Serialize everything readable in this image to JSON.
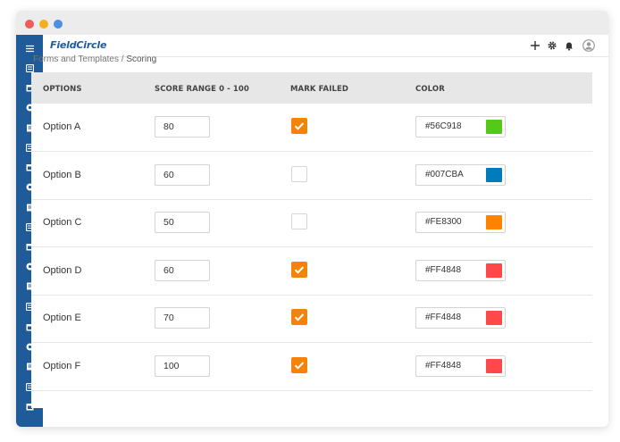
{
  "app": {
    "logo": "FieldCircle"
  },
  "breadcrumb": {
    "parent": "Forms and Templates",
    "separator": " / ",
    "current": "Scoring"
  },
  "table": {
    "headers": {
      "options": "OPTIONS",
      "score": "SCORE RANGE 0 - 100",
      "mark_failed": "MARK FAILED",
      "color": "COLOR"
    },
    "rows": [
      {
        "label": "Option A",
        "score": "80",
        "failed": true,
        "color": "#56C918"
      },
      {
        "label": "Option B",
        "score": "60",
        "failed": false,
        "color": "#007CBA"
      },
      {
        "label": "Option C",
        "score": "50",
        "failed": false,
        "color": "#FE8300"
      },
      {
        "label": "Option D",
        "score": "60",
        "failed": true,
        "color": "#FF4848"
      },
      {
        "label": "Option E",
        "score": "70",
        "failed": true,
        "color": "#FF4848"
      },
      {
        "label": "Option F",
        "score": "100",
        "failed": true,
        "color": "#FF4848"
      }
    ]
  },
  "sidebar": {
    "icons": [
      "menu-icon",
      "dashboard-icon",
      "calendar-icon",
      "dispatch-icon",
      "clipboard-icon",
      "document-icon",
      "checklist-icon",
      "briefcase-icon",
      "technician-icon",
      "invoice-icon",
      "list-icon",
      "truck-icon",
      "report-icon",
      "hierarchy-icon",
      "money-icon",
      "users-icon",
      "monitor-icon",
      "clock-icon",
      "notes-icon"
    ]
  },
  "topbar": {
    "icons": [
      "plus-icon",
      "gear-icon",
      "bell-icon",
      "user-avatar-icon"
    ]
  },
  "theme": {
    "sidebar": "#1f5a99",
    "checkbox": "#f5830a",
    "header_bg": "#e7e7e7"
  }
}
